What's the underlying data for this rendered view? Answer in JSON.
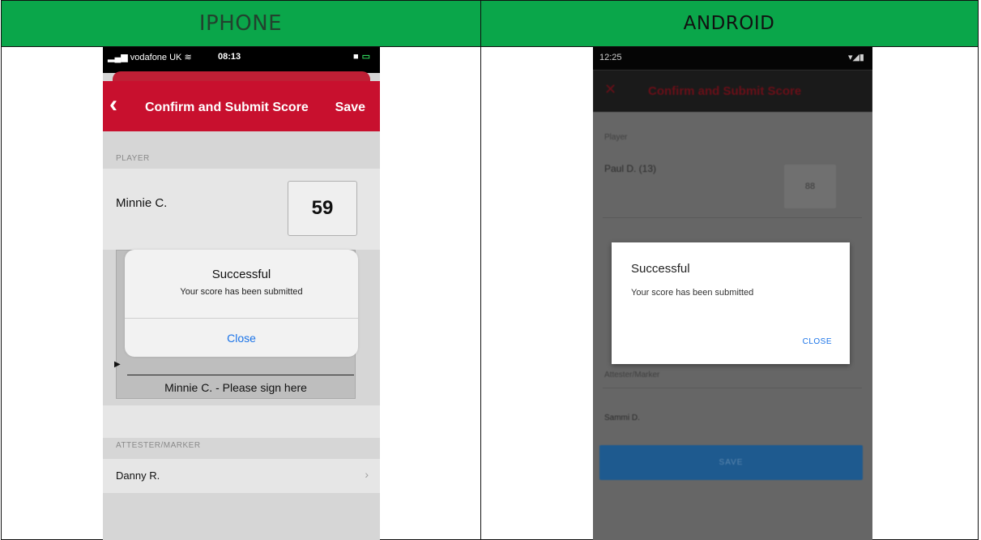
{
  "table": {
    "left_header": "IPHONE",
    "right_header": "ANDROID",
    "header_color": "#0aa64a"
  },
  "iphone": {
    "status": {
      "carrier": "vodafone UK",
      "time": "08:13"
    },
    "navbar": {
      "title": "Confirm and Submit Score",
      "save_label": "Save",
      "color": "#c8102e"
    },
    "player_section_label": "PLAYER",
    "player_name": "Minnie C.",
    "score": "59",
    "signature_label": "Minnie C. - Please sign here",
    "attester_section_label": "ATTESTER/MARKER",
    "attester_name": "Danny R.",
    "alert": {
      "title": "Successful",
      "message": "Your score has been submitted",
      "button": "Close"
    }
  },
  "android": {
    "status": {
      "time": "12:25"
    },
    "appbar": {
      "title": "Confirm and Submit Score"
    },
    "player_label": "Player",
    "player_name": "Paul D. (13)",
    "score": "88",
    "attester_label": "Attester/Marker",
    "attester_name": "Sammi D.",
    "save_label": "SAVE",
    "dialog": {
      "title": "Successful",
      "message": "Your score has been submitted",
      "button": "CLOSE"
    }
  }
}
